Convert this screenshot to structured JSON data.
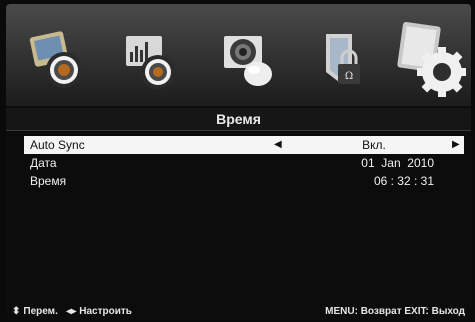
{
  "icons": [
    {
      "name": "picture-icon"
    },
    {
      "name": "sound-icon"
    },
    {
      "name": "channel-icon"
    },
    {
      "name": "lock-icon"
    },
    {
      "name": "settings-gear-icon"
    }
  ],
  "header": {
    "title": "Время"
  },
  "menu": {
    "rows": [
      {
        "label": "Auto Sync",
        "value": "Вкл."
      },
      {
        "label": "Дата",
        "value": "01  Jan  2010"
      },
      {
        "label": "Время",
        "value": "06 : 32 : 31"
      }
    ]
  },
  "footer": {
    "move": "Перем.",
    "adjust": "Настроить",
    "menu_hint": "MENU: Возврат",
    "exit_hint": "EXIT: Выход"
  },
  "colors": {
    "selected_row": "#f5f5f5",
    "background": "#0c0c0c"
  }
}
